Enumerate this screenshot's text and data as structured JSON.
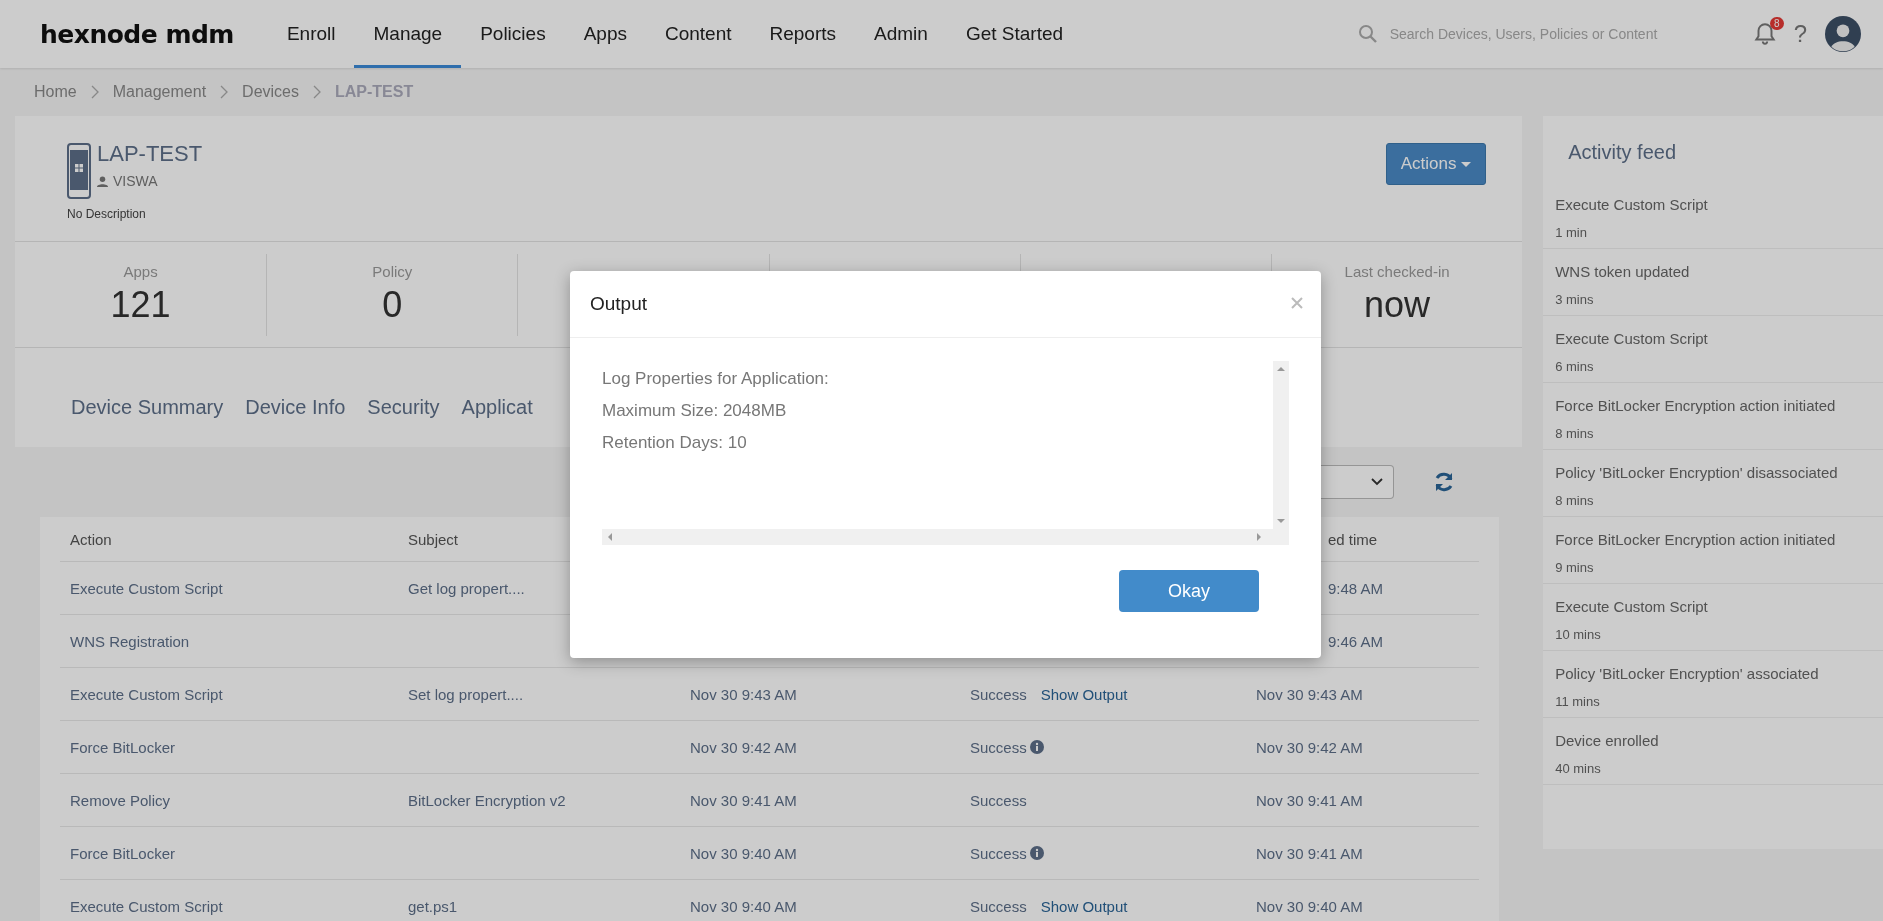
{
  "topbar": {
    "logo": "hexnode mdm",
    "nav": [
      {
        "label": "Enroll",
        "selected": false
      },
      {
        "label": "Manage",
        "selected": true
      },
      {
        "label": "Policies",
        "selected": false
      },
      {
        "label": "Apps",
        "selected": false
      },
      {
        "label": "Content",
        "selected": false
      },
      {
        "label": "Reports",
        "selected": false
      },
      {
        "label": "Admin",
        "selected": false
      },
      {
        "label": "Get Started",
        "selected": false
      }
    ],
    "search": {
      "placeholder": "Search Devices, Users, Policies or Content"
    },
    "notifications": "8",
    "help": "?"
  },
  "breadcrumb": [
    "Home",
    "Management",
    "Devices",
    "LAP-TEST"
  ],
  "device": {
    "name": "LAP-TEST",
    "user": "VISWA",
    "description": "No Description",
    "actions_button": "Actions"
  },
  "stats": [
    {
      "label": "Apps",
      "value": "121"
    },
    {
      "label": "Policy",
      "value": "0"
    },
    {
      "label": "Last checked-in",
      "value": "now"
    }
  ],
  "tabs": [
    {
      "label": "Device Summary",
      "selected": false
    },
    {
      "label": "Device Info",
      "selected": false
    },
    {
      "label": "Security",
      "selected": false
    },
    {
      "label": "Applicat",
      "selected": false
    }
  ],
  "table": {
    "columns": [
      "Action",
      "Subject",
      "ed time"
    ],
    "rows": [
      {
        "covered": true,
        "action": "Execute Custom Script",
        "subject": "Get log propert....",
        "time": "9:48 AM"
      },
      {
        "covered": true,
        "action": "WNS Registration",
        "time": "9:46 AM"
      },
      {
        "covered": false,
        "action": "Execute Custom Script",
        "subject": "Set log propert....",
        "date": "Nov 30 9:43 AM",
        "status": "Success",
        "kind": "link",
        "link": "Show Output",
        "time": "Nov 30 9:43 AM"
      },
      {
        "covered": false,
        "action": "Force BitLocker",
        "date": "Nov 30 9:42 AM",
        "status": "Success",
        "kind": "info",
        "time": "Nov 30 9:42 AM"
      },
      {
        "covered": false,
        "action": "Remove Policy",
        "subject": "BitLocker Encryption v2",
        "date": "Nov 30 9:41 AM",
        "status": "Success",
        "kind": "plain",
        "time": "Nov 30 9:41 AM"
      },
      {
        "covered": false,
        "action": "Force BitLocker",
        "date": "Nov 30 9:40 AM",
        "status": "Success",
        "kind": "info",
        "time": "Nov 30 9:41 AM"
      },
      {
        "covered": false,
        "action": "Execute Custom Script",
        "subject": "get.ps1",
        "date": "Nov 30 9:40 AM",
        "status": "Success",
        "kind": "link",
        "link": "Show Output",
        "time": "Nov 30 9:40 AM"
      }
    ]
  },
  "activity_feed": {
    "title": "Activity feed",
    "items": [
      {
        "text": "Execute Custom Script",
        "time": "1 min"
      },
      {
        "text": "WNS token updated",
        "time": "3 mins"
      },
      {
        "text": "Execute Custom Script",
        "time": "6 mins"
      },
      {
        "text": "Force BitLocker Encryption action initiated",
        "time": "8 mins"
      },
      {
        "text": "Policy 'BitLocker Encryption' disassociated",
        "time": "8 mins"
      },
      {
        "text": "Force BitLocker Encryption action initiated",
        "time": "9 mins"
      },
      {
        "text": "Execute Custom Script",
        "time": "10 mins"
      },
      {
        "text": "Policy 'BitLocker Encryption' associated",
        "time": "11 mins"
      },
      {
        "text": "Device enrolled",
        "time": "40 mins"
      }
    ]
  },
  "modal": {
    "title": "Output",
    "lines": [
      "Log Properties for Application:",
      "Maximum Size: 2048MB",
      "Retention Days: 10"
    ],
    "button": "Okay"
  }
}
